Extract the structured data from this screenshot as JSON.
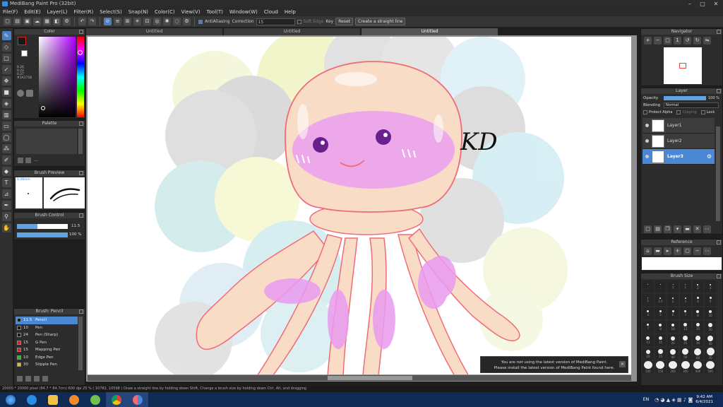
{
  "window": {
    "title": "MediBang Paint Pro (32bit)",
    "minimize": "–",
    "maximize": "□",
    "close": "✕"
  },
  "menu": [
    "File(F)",
    "Edit(E)",
    "Layer(L)",
    "Filter(R)",
    "Select(S)",
    "Snap(N)",
    "Color(C)",
    "View(V)",
    "Tool(T)",
    "Window(W)",
    "Cloud",
    "Help"
  ],
  "toolbar": {
    "antialias_label": "AntiAliasing",
    "correction_label": "Correction",
    "correction_value": "15",
    "soft_edge_label": "Soft Edge",
    "key_label": "Key",
    "reset_label": "Reset",
    "straight_line_label": "Create a straight line"
  },
  "tabs": [
    "Untitled",
    "Untitled",
    "Untitled"
  ],
  "color_panel": {
    "title": "Color",
    "readout": [
      "0.26",
      "0.22",
      "0.27"
    ],
    "hex": "#1A1718"
  },
  "palette_panel": {
    "title": "Palette"
  },
  "brush_preview": {
    "title": "Brush Preview",
    "size": "0.49mm"
  },
  "brush_control": {
    "title": "Brush Control",
    "size_value": "11.5",
    "opacity_value": "100 %",
    "size_fraction": 0.4,
    "opacity_fraction": 1.0
  },
  "brush_list": {
    "title": "Brush: Pencil",
    "items": [
      {
        "size": "11.5",
        "name": "Pencil",
        "color": "#1a1a1a",
        "active": true
      },
      {
        "size": "10",
        "name": "Pen",
        "color": "#1a1a1a",
        "active": false
      },
      {
        "size": "24",
        "name": "Pen (Sharp)",
        "color": "#1a1a1a",
        "active": false
      },
      {
        "size": "15",
        "name": "G Pen",
        "color": "#e02020",
        "active": false
      },
      {
        "size": "15",
        "name": "Mapping Pen",
        "color": "#e02020",
        "active": false
      },
      {
        "size": "10",
        "name": "Edge Pen",
        "color": "#20c020",
        "active": false
      },
      {
        "size": "30",
        "name": "Stipple Pen",
        "color": "#e0c020",
        "active": false
      }
    ]
  },
  "navigator": {
    "title": "Navigator"
  },
  "layer_panel": {
    "title": "Layer",
    "opacity_label": "Opacity",
    "opacity_value": "100 %",
    "blending_label": "Blending",
    "blending_value": "Normal",
    "protect_alpha_label": "Protect Alpha",
    "clipping_label": "Clipping",
    "lock_label": "Lock",
    "layers": [
      {
        "name": "Layer1",
        "active": false
      },
      {
        "name": "Layer2",
        "active": false
      },
      {
        "name": "Layer3",
        "active": true
      }
    ]
  },
  "reference_panel": {
    "title": "Reference"
  },
  "brush_size_panel": {
    "title": "Brush Size",
    "sizes": [
      ".",
      ".",
      "1",
      "1",
      "2",
      "3",
      "1",
      "1.5",
      "2",
      "3",
      "4",
      "5",
      "4",
      "5",
      "6",
      "7",
      "8",
      "10",
      "7",
      "8",
      "10",
      "13",
      "15",
      "20",
      "13",
      "15",
      "20",
      "25",
      "30",
      "40",
      "20",
      "25",
      "40",
      "50",
      "60",
      "70",
      "100",
      "150",
      "200",
      "300",
      "400",
      "500"
    ]
  },
  "status_bar": {
    "text": "20000 * 20000 pixel  (84.7 * 84.7cm)  600 dpi  25 %  ( 10782, 10598 )  Draw a straight line by holding down Shift, Change a brush size by holding down Ctrl, Alt, and dragging"
  },
  "notice": {
    "line1": "You are not using the latest version of MediBang Paint.",
    "line2": "Please install the latest version of MediBang Paint found here.",
    "close": "✕"
  },
  "signature_text": "KD",
  "taskbar": {
    "lang": "EN",
    "time": "9:42 AM",
    "date": "6/4/2021"
  },
  "colors": {
    "accent": "#4a88d6",
    "jelly_skin": "#f9dcc6",
    "jelly_outline": "#f06b77",
    "jelly_pink": "#e99bf0",
    "eye": "#6a1f8f"
  }
}
